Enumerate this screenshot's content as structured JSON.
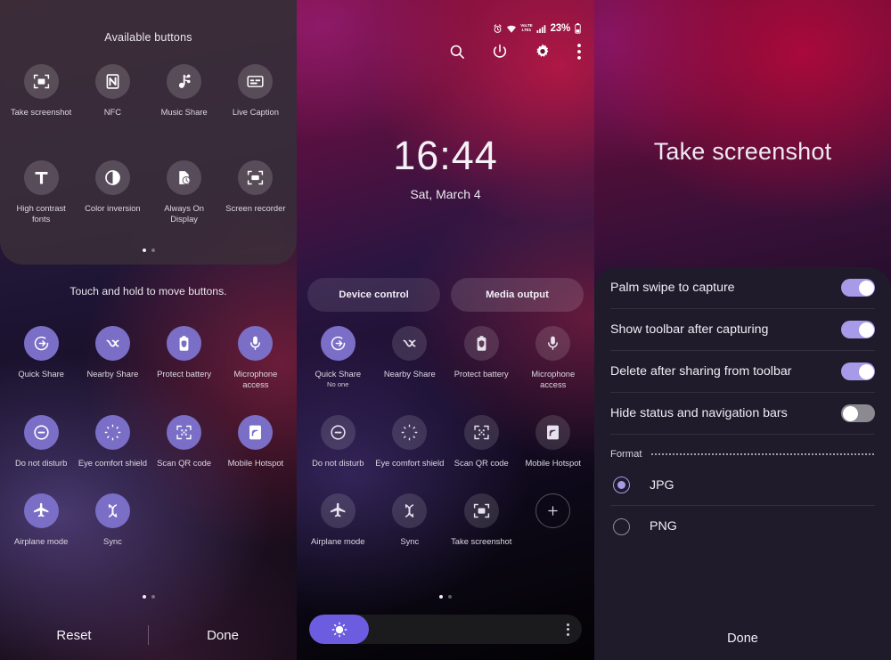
{
  "panels": {
    "edit_panel": {
      "available_title": "Available buttons",
      "available_buttons": [
        {
          "label": "Take screenshot",
          "icon": "screenshot-icon"
        },
        {
          "label": "NFC",
          "icon": "nfc-icon"
        },
        {
          "label": "Music Share",
          "icon": "music-share-icon"
        },
        {
          "label": "Live Caption",
          "icon": "live-caption-icon"
        },
        {
          "label": "High contrast fonts",
          "icon": "text-t-icon"
        },
        {
          "label": "Color inversion",
          "icon": "contrast-circle-icon"
        },
        {
          "label": "Always On Display",
          "icon": "clock-page-icon"
        },
        {
          "label": "Screen recorder",
          "icon": "screen-recorder-icon"
        }
      ],
      "move_hint": "Touch and hold to move buttons.",
      "active_buttons": [
        {
          "label": "Quick Share",
          "icon": "quick-share-icon",
          "state": "on"
        },
        {
          "label": "Nearby Share",
          "icon": "nearby-share-icon",
          "state": "on"
        },
        {
          "label": "Protect battery",
          "icon": "protect-battery-icon",
          "state": "on"
        },
        {
          "label": "Microphone access",
          "icon": "microphone-icon",
          "state": "on"
        },
        {
          "label": "Do not disturb",
          "icon": "do-not-disturb-icon",
          "state": "on"
        },
        {
          "label": "Eye comfort shield",
          "icon": "eye-comfort-icon",
          "state": "on"
        },
        {
          "label": "Scan QR code",
          "icon": "qr-code-icon",
          "state": "on"
        },
        {
          "label": "Mobile Hotspot",
          "icon": "hotspot-icon",
          "state": "on"
        },
        {
          "label": "Airplane mode",
          "icon": "airplane-icon",
          "state": "on"
        },
        {
          "label": "Sync",
          "icon": "sync-icon",
          "state": "on"
        }
      ],
      "reset_label": "Reset",
      "done_label": "Done",
      "page_dots": 2,
      "page_active": 0
    },
    "quick_settings": {
      "status_bar": {
        "battery_percent": "23%",
        "icons": [
          "alarm-icon",
          "wifi-icon",
          "volte-icon",
          "signal-icon",
          "battery-icon"
        ],
        "volte_top": "VoLTE",
        "volte_bottom": "LTE1"
      },
      "toolbar_icons": [
        "search-icon",
        "power-icon",
        "gear-icon",
        "more-options-icon"
      ],
      "clock_time": "16:44",
      "clock_date": "Sat, March 4",
      "pills": [
        {
          "label": "Device control"
        },
        {
          "label": "Media output"
        }
      ],
      "tiles": [
        {
          "label": "Quick Share",
          "sublabel": "No one",
          "icon": "quick-share-icon",
          "state": "on"
        },
        {
          "label": "Nearby Share",
          "sublabel": "",
          "icon": "nearby-share-icon",
          "state": "off"
        },
        {
          "label": "Protect battery",
          "sublabel": "",
          "icon": "protect-battery-icon",
          "state": "off"
        },
        {
          "label": "Microphone access",
          "sublabel": "",
          "icon": "microphone-icon",
          "state": "off"
        },
        {
          "label": "Do not disturb",
          "sublabel": "",
          "icon": "do-not-disturb-icon",
          "state": "off"
        },
        {
          "label": "Eye comfort shield",
          "sublabel": "",
          "icon": "eye-comfort-icon",
          "state": "off"
        },
        {
          "label": "Scan QR code",
          "sublabel": "",
          "icon": "qr-code-icon",
          "state": "off"
        },
        {
          "label": "Mobile Hotspot",
          "sublabel": "",
          "icon": "hotspot-icon",
          "state": "off"
        },
        {
          "label": "Airplane mode",
          "sublabel": "",
          "icon": "airplane-icon",
          "state": "off"
        },
        {
          "label": "Sync",
          "sublabel": "",
          "icon": "sync-icon",
          "state": "off"
        },
        {
          "label": "Take screenshot",
          "sublabel": "",
          "icon": "screenshot-icon",
          "state": "off"
        },
        {
          "label": "",
          "sublabel": "",
          "icon": "add-plus-icon",
          "state": "add"
        }
      ],
      "brightness_percent": 22,
      "brightness_icon": "brightness-sun-icon",
      "brightness_more_icon": "more-options-icon",
      "page_dots": 2,
      "page_active": 0
    },
    "screenshot_settings": {
      "title": "Take screenshot",
      "switches": [
        {
          "label": "Palm swipe to capture",
          "on": true
        },
        {
          "label": "Show toolbar after capturing",
          "on": true
        },
        {
          "label": "Delete after sharing from toolbar",
          "on": true
        },
        {
          "label": "Hide status and navigation bars",
          "on": false
        }
      ],
      "format_label": "Format",
      "format_options": [
        {
          "label": "JPG",
          "selected": true
        },
        {
          "label": "PNG",
          "selected": false
        }
      ],
      "done_label": "Done"
    }
  },
  "colors": {
    "accent_purple": "#7a6ec6",
    "toggle_on": "#a79ae8",
    "toggle_off": "#8a8a90",
    "sheet_bg": "#1f1b2b",
    "brightness_fill": "#6c5ce0"
  }
}
